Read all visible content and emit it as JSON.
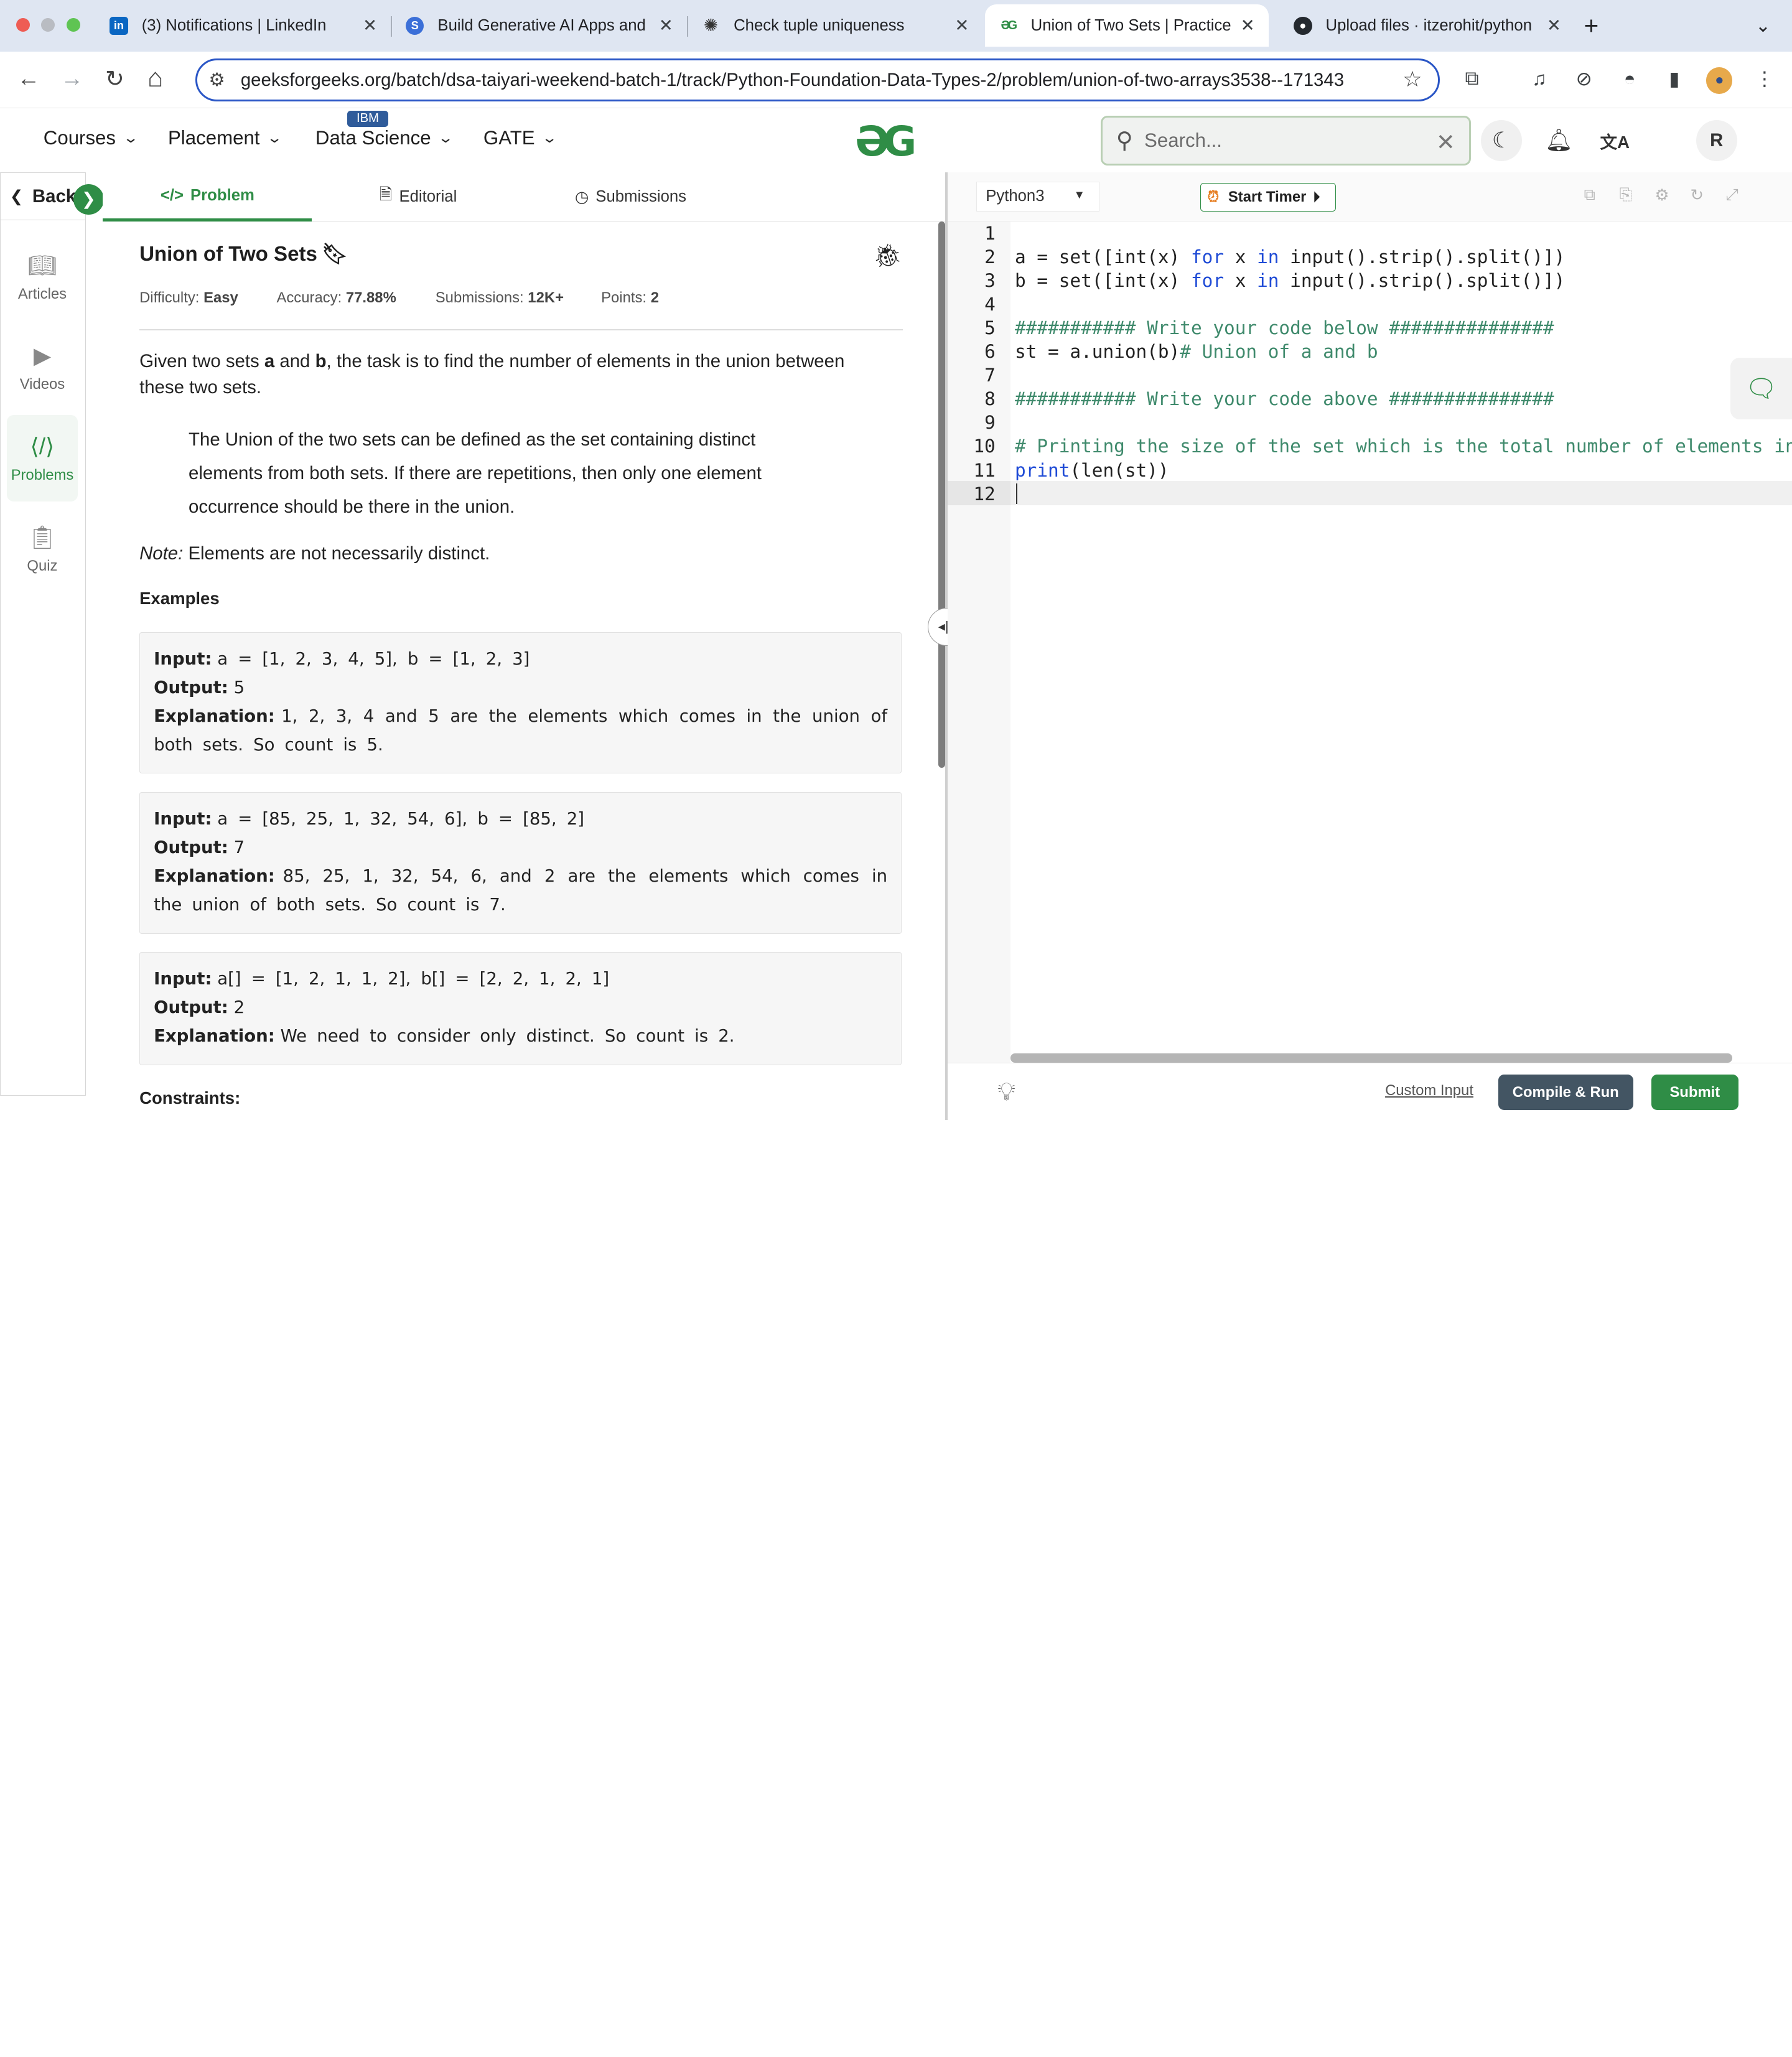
{
  "browser": {
    "tabs": [
      {
        "title": "(3) Notifications | LinkedIn",
        "favicon": "linkedin-icon",
        "color": "#0a66c2"
      },
      {
        "title": "Build Generative AI Apps and",
        "favicon": "ai-icon",
        "color": "#3b6fd8"
      },
      {
        "title": "Check tuple uniqueness",
        "favicon": "chatgpt-icon",
        "color": "#333333"
      },
      {
        "title": "Union of Two Sets | Practice |",
        "favicon": "gfg-icon",
        "color": "#2f8d46"
      },
      {
        "title": "Upload files · itzerohit/python",
        "favicon": "github-icon",
        "color": "#24292f"
      }
    ],
    "new_tab": "+",
    "url": "geeksforgeeks.org/batch/dsa-taiyari-weekend-batch-1/track/Python-Foundation-Data-Types-2/problem/union-of-two-arrays3538--171343"
  },
  "header": {
    "nav": [
      "Courses",
      "Placement",
      "Data Science",
      "GATE"
    ],
    "ibm_badge": "IBM",
    "logo": "ƏG",
    "search_placeholder": "Search...",
    "avatar_letter": "R",
    "brand_color": "#2f8d46"
  },
  "rail": {
    "back_label": "Back",
    "items": [
      {
        "label": "Articles",
        "icon": "book-icon"
      },
      {
        "label": "Videos",
        "icon": "play-icon"
      },
      {
        "label": "Problems",
        "icon": "code-icon"
      },
      {
        "label": "Quiz",
        "icon": "clipboard-icon"
      }
    ]
  },
  "problem": {
    "tabs": [
      "Problem",
      "Editorial",
      "Submissions"
    ],
    "title": "Union of Two Sets",
    "meta": {
      "difficulty_label": "Difficulty:",
      "difficulty": "Easy",
      "accuracy_label": "Accuracy:",
      "accuracy": "77.88%",
      "submissions_label": "Submissions:",
      "submissions": "12K+",
      "points_label": "Points:",
      "points": "2"
    },
    "intro_pre": "Given two sets ",
    "intro_a": "a",
    "intro_mid": " and ",
    "intro_b": "b",
    "intro_post": ", the task is to find the number of elements in the union between these two sets.",
    "quote": "The Union of the two sets can be defined as the set containing distinct elements from both sets. If there are repetitions, then only one element occurrence should be there in the union.",
    "note_label": "Note:",
    "note_text": " Elements are not necessarily distinct.",
    "examples_heading": "Examples",
    "examples": [
      {
        "input": "a = [1, 2, 3, 4, 5], b = [1, 2, 3]",
        "output": "5",
        "explanation": "1, 2, 3, 4 and 5 are the elements which comes in the union of both sets. So count is 5."
      },
      {
        "input": "a = [85, 25, 1, 32, 54, 6], b = [85, 2]",
        "output": "7",
        "explanation": "85, 25, 1, 32, 54, 6, and 2 are the elements which comes in the union of both sets. So count is 7."
      },
      {
        "input": "a[] = [1, 2, 1, 1, 2], b[] = [2, 2, 1, 2, 1]",
        "output": "2",
        "explanation": "We need to consider only distinct. So count is 2."
      }
    ],
    "input_label": "Input:",
    "output_label": "Output:",
    "explanation_label": "Explanation:",
    "constraints_heading": "Constraints:"
  },
  "editor": {
    "language": "Python3",
    "timer_label": "Start Timer",
    "line_numbers": [
      "1",
      "2",
      "3",
      "4",
      "5",
      "6",
      "7",
      "8",
      "9",
      "10",
      "11",
      "12"
    ],
    "current_line": "12",
    "custom_input": "Custom Input",
    "compile_run": "Compile & Run",
    "submit": "Submit"
  }
}
